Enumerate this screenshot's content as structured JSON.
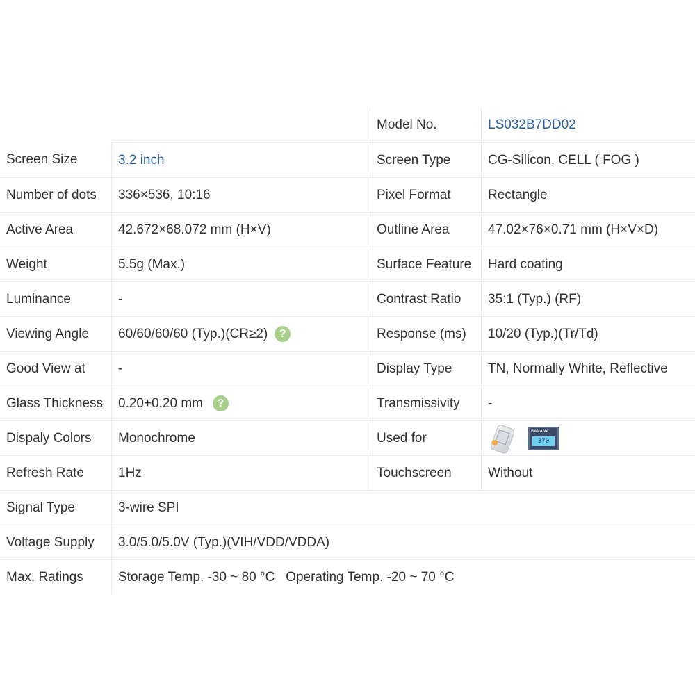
{
  "rows": [
    {
      "l1": "",
      "v1": "",
      "l2": "Model No.",
      "v2": "LS032B7DD02"
    },
    {
      "l1": "Screen Size",
      "v1": "3.2 inch",
      "l2": "Screen Type",
      "v2": "CG-Silicon, CELL ( FOG )"
    },
    {
      "l1": "Number of dots",
      "v1": "336×536, 10:16",
      "l2": "Pixel Format",
      "v2": "Rectangle"
    },
    {
      "l1": "Active Area",
      "v1": "42.672×68.072 mm (H×V)",
      "l2": "Outline Area",
      "v2": "47.02×76×0.71 mm (H×V×D)"
    },
    {
      "l1": "Weight",
      "v1": "5.5g (Max.)",
      "l2": "Surface Feature",
      "v2": "Hard coating"
    },
    {
      "l1": "Luminance",
      "v1": "-",
      "l2": "Contrast Ratio",
      "v2": "35:1 (Typ.) (RF)"
    },
    {
      "l1": "Viewing Angle",
      "v1": "60/60/60/60 (Typ.)(CR≥2)",
      "l2": "Response (ms)",
      "v2": "10/20 (Typ.)(Tr/Td)"
    },
    {
      "l1": "Good View at",
      "v1": "-",
      "l2": "Display Type",
      "v2": "TN, Normally White, Reflective"
    },
    {
      "l1": "Glass Thickness",
      "v1": "0.20+0.20 mm",
      "l2": "Transmissivity",
      "v2": "-"
    },
    {
      "l1": "Dispaly Colors",
      "v1": "Monochrome",
      "l2": "Used for",
      "v2": ""
    },
    {
      "l1": "Refresh Rate",
      "v1": "1Hz",
      "l2": "Touchscreen",
      "v2": "Without"
    },
    {
      "l1": "Signal Type",
      "v1": "3-wire SPI"
    },
    {
      "l1": "Voltage Supply",
      "v1": "3.0/5.0/5.0V (Typ.)(VIH/VDD/VDDA)"
    },
    {
      "l1": "Max. Ratings",
      "v1": "Storage Temp. -30 ~ 80 °C   Operating Temp. -20 ~ 70 °C"
    }
  ],
  "help_icon": {
    "glyph": "?",
    "icon": "question-circle-icon",
    "color": "#a7cf8a"
  },
  "used_for_thumbs": {
    "thumb1": "phone-device-icon",
    "banana_brand": "BANANA",
    "banana_value": "370"
  },
  "colors": {
    "link": "#2a5d9a",
    "text": "#333333",
    "border": "#ececec"
  }
}
